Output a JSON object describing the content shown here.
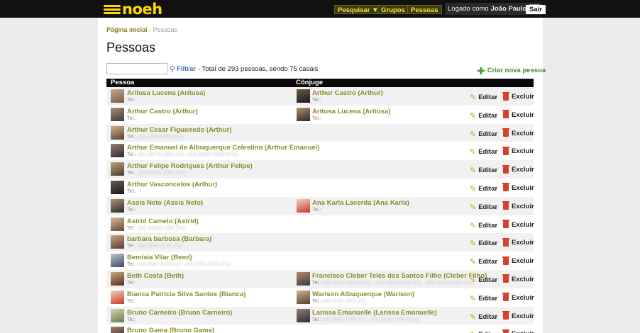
{
  "header": {
    "logo_text": "noeh",
    "nav": [
      "Pesquisar ▼",
      "Grupos",
      "Pessoas"
    ],
    "logged_prefix": "Logado como",
    "user_name": "João Paulo",
    "logout_label": "Sair"
  },
  "breadcrumb": {
    "home": "Página inicial",
    "separator": "›",
    "current": "Pessoas"
  },
  "page_title": "Pessoas",
  "filter": {
    "search_value": "",
    "filter_label": "Filtrar",
    "summary": "- Total de 293 pessoas, sendo 75 casais"
  },
  "new_person_label": "Criar nova pessoa",
  "table": {
    "headers": [
      "Pessoa",
      "Cônjuge"
    ],
    "tel_label": "Tel.:",
    "edit_label": "Editar",
    "delete_label": "Excluir",
    "rows": [
      {
        "person": "Aritusa Lucena (Aritusa)",
        "person_tel": "",
        "spouse": "Arthur Castro (Arthur)",
        "spouse_tel": ""
      },
      {
        "person": "Arthur Castro (Arthur)",
        "person_tel": "",
        "spouse": "Aritusa Lucena (Aritusa)",
        "spouse_tel": ""
      },
      {
        "person": "Arthur Cesar Figueiredo (Arthur)",
        "person_tel": "(83) 9999-9999 (Fix)",
        "spouse": "",
        "spouse_tel": ""
      },
      {
        "person": "Arthur Emanuel de Albuquerque Celestino (Arthur Emanuel)",
        "person_tel": "(83) 98770-1884 (Cl) - (83) 99999-9999 (Fixo)",
        "spouse": "",
        "spouse_tel": ""
      },
      {
        "person": "Arthur Felipe Rodrigues (Arthur Felipe)",
        "person_tel": "(83) 93331-1955 (Fix)",
        "spouse": "",
        "spouse_tel": ""
      },
      {
        "person": "Arthur Vasconcelos (Arthur)",
        "person_tel": "",
        "spouse": "",
        "spouse_tel": ""
      },
      {
        "person": "Assis Neto (Assis Neto)",
        "person_tel": "",
        "spouse": "Ana Karla Lacerda (Ana Karla)",
        "spouse_tel": ""
      },
      {
        "person": "Astrid Camelo (Astrid)",
        "person_tel": "(83) 94804-1355 (Fix)",
        "spouse": "",
        "spouse_tel": ""
      },
      {
        "person": "barbara barbosa (Barbara)",
        "person_tel": "(83) 9849-9133 (Fix)",
        "spouse": "",
        "spouse_tel": ""
      },
      {
        "person": "Bemisia Vilar (Bemi)",
        "person_tel": "(83) 9997-9100 (Cl) - (83) 3351-9784 (Fix)",
        "spouse": "",
        "spouse_tel": ""
      },
      {
        "person": "Beth Costa (Beth)",
        "person_tel": "",
        "spouse": "Francisco Cleber Teles dos Santos Filho (Cleber Filho)",
        "spouse_tel": "(83) 3333-1944 (Fixo) - (83) 98856-4066 (Cl) - (83) 99938-5344 (Fix)"
      },
      {
        "person": "Bianca Patricia Silva Santos (Bianca)",
        "person_tel": "",
        "spouse": "Warison Albuquerque (Warison)",
        "spouse_tel": "(83) 8791-1617 (Cl)"
      },
      {
        "person": "Bruno Carneiro (Bruno Carneiro)",
        "person_tel": "",
        "spouse": "Larissa Emanuelle (Larissa Emanuelle)",
        "spouse_tel": "(83) 9881-9785 (Cl) - (83) 3333-1500 (Fixo)"
      },
      {
        "person": "Bruno Gama (Bruno Gama)",
        "person_tel": "",
        "spouse": "",
        "spouse_tel": ""
      }
    ]
  },
  "colors": {
    "accent_yellow": "#ffd800",
    "name_olive": "#8d8a2a",
    "delete_red": "#d4402a",
    "new_green": "#4aa02a"
  }
}
